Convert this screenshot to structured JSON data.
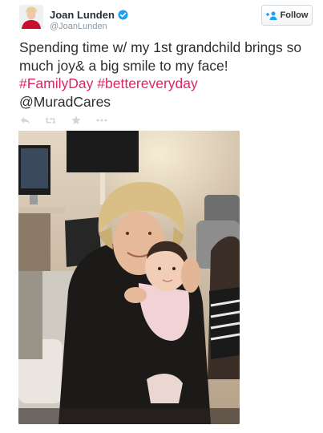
{
  "user": {
    "display_name": "Joan Lunden",
    "handle": "@JoanLunden",
    "verified": true
  },
  "follow_button": {
    "label": "Follow",
    "icon": "person-plus-icon"
  },
  "tweet": {
    "text_line1": "Spending time w/ my 1st grandchild brings so much joy& a big smile to my face!",
    "hashtag1": "#FamilyDay",
    "hashtag2": "#bettereveryday",
    "mention": "@MuradCares"
  },
  "actions": [
    {
      "name": "reply-icon"
    },
    {
      "name": "retweet-icon"
    },
    {
      "name": "favorite-icon"
    },
    {
      "name": "more-icon"
    }
  ],
  "colors": {
    "hashtag": "#e0245e",
    "verified": "#1da1f2",
    "action_icon": "#ccd6dd",
    "handle": "#8899a6"
  }
}
